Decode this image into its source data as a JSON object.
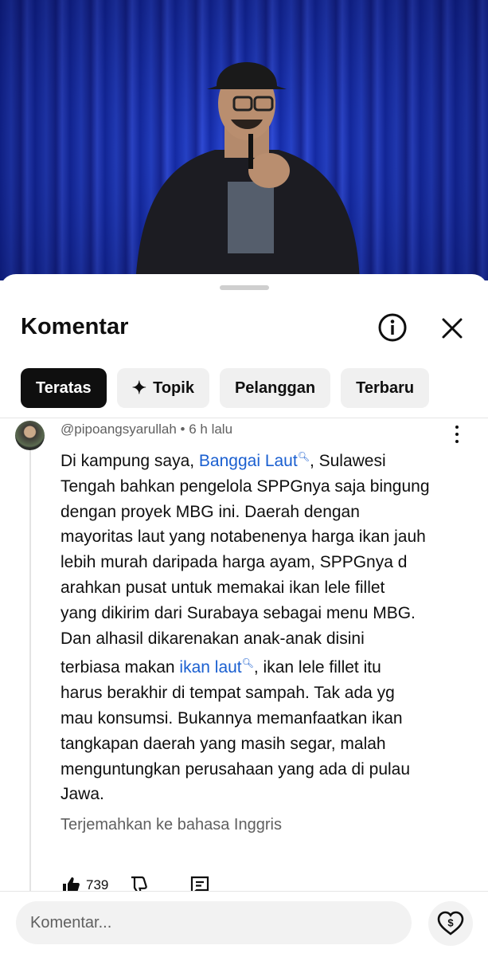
{
  "header": {
    "title": "Komentar",
    "info_icon": "info-circle-icon",
    "close_icon": "close-icon"
  },
  "filters": [
    {
      "label": "Teratas",
      "active": true
    },
    {
      "label": "Topik",
      "active": false,
      "icon": "sparkle-icon"
    },
    {
      "label": "Pelanggan",
      "active": false
    },
    {
      "label": "Terbaru",
      "active": false
    }
  ],
  "comment": {
    "author": "@pipoangsyarullah",
    "time": "6 h lalu",
    "lines": [
      {
        "before": "Di kampung saya, ",
        "link": "Banggai Laut",
        "after": ", Sulawesi"
      },
      {
        "text": "Tengah bahkan pengelola SPPGnya saja bingung"
      },
      {
        "text": "dengan proyek MBG ini. Daerah dengan"
      },
      {
        "text": "mayoritas laut yang notabenenya harga ikan jauh"
      },
      {
        "text": "lebih murah daripada harga ayam, SPPGnya d"
      },
      {
        "text": "arahkan pusat untuk memakai ikan lele fillet"
      },
      {
        "text": "yang dikirim dari Surabaya sebagai menu MBG."
      },
      {
        "text": "Dan alhasil dikarenakan anak-anak disini"
      },
      {
        "before": "terbiasa makan ",
        "link": "ikan laut",
        "after": ", ikan lele fillet itu"
      },
      {
        "text": "harus berakhir di tempat sampah. Tak ada yg"
      },
      {
        "text": "mau konsumsi. Bukannya memanfaatkan ikan"
      },
      {
        "text": "tangkapan daerah yang masih segar, malah"
      },
      {
        "text": "menguntungkan perusahaan yang ada di pulau"
      },
      {
        "text": "Jawa."
      }
    ],
    "translate_label": "Terjemahkan ke bahasa Inggris",
    "like_count": "739"
  },
  "composer": {
    "placeholder": "Komentar...",
    "thanks_icon": "super-thanks-icon"
  },
  "colors": {
    "link": "#1a5fd0",
    "chip_active_bg": "#0f0f0f",
    "chip_bg": "#f0f0f0",
    "curtain": "#2f52f0"
  }
}
